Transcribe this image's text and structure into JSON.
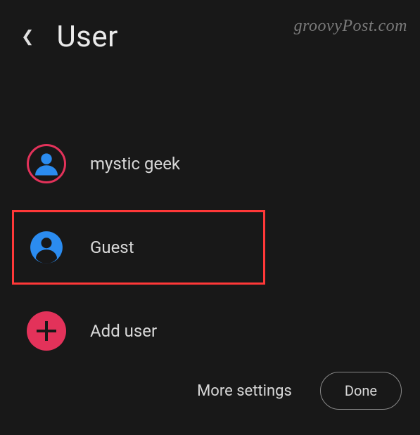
{
  "header": {
    "title": "User"
  },
  "watermark": "groovyPost.com",
  "users": [
    {
      "label": "mystic geek"
    },
    {
      "label": "Guest"
    },
    {
      "label": "Add user"
    }
  ],
  "footer": {
    "more_settings": "More settings",
    "done": "Done"
  },
  "colors": {
    "accent_blue": "#2b8cf0",
    "accent_pink": "#e3325a",
    "highlight_red": "#ff3838"
  }
}
